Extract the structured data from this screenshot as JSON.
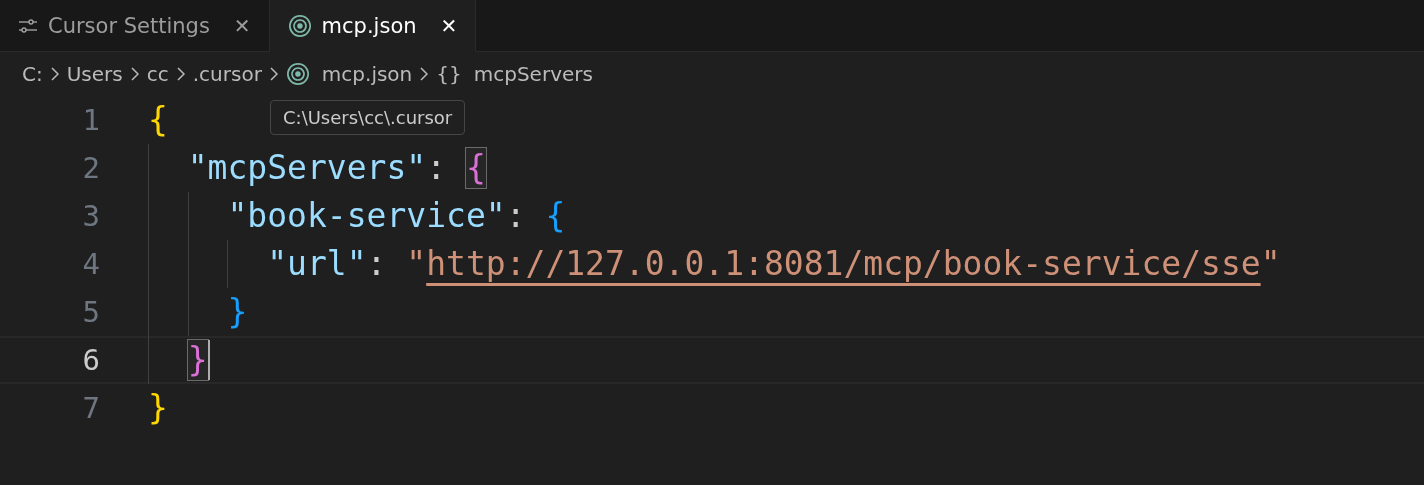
{
  "tabs": [
    {
      "label": "Cursor Settings",
      "kind": "settings",
      "selected": false,
      "close": "✕"
    },
    {
      "label": "mcp.json",
      "kind": "json",
      "selected": true,
      "close": "✕"
    }
  ],
  "breadcrumb": [
    {
      "label": "C:",
      "kind": "folder"
    },
    {
      "label": "Users",
      "kind": "folder"
    },
    {
      "label": "cc",
      "kind": "folder"
    },
    {
      "label": ".cursor",
      "kind": "folder"
    },
    {
      "label": "mcp.json",
      "kind": "file"
    },
    {
      "label": "mcpServers",
      "kind": "symbol",
      "symbol": "{}"
    }
  ],
  "tooltip": "C:\\Users\\cc\\.cursor",
  "editor": {
    "lines": [
      {
        "number": "1",
        "current": false,
        "cursor": false,
        "tokens": [
          {
            "kind": "brace1",
            "text": "{",
            "matched": false
          }
        ]
      },
      {
        "number": "2",
        "current": false,
        "cursor": false,
        "tokens": [
          {
            "kind": "key",
            "text": "\"mcpServers\"",
            "matched": false
          },
          {
            "kind": "punct",
            "text": ": ",
            "matched": false
          },
          {
            "kind": "brace2",
            "text": "{",
            "matched": true
          }
        ]
      },
      {
        "number": "3",
        "current": false,
        "cursor": false,
        "tokens": [
          {
            "kind": "key",
            "text": "\"book-service\"",
            "matched": false
          },
          {
            "kind": "punct",
            "text": ": ",
            "matched": false
          },
          {
            "kind": "brace3",
            "text": "{",
            "matched": false
          }
        ]
      },
      {
        "number": "4",
        "current": false,
        "cursor": false,
        "tokens": [
          {
            "kind": "key",
            "text": "\"url\"",
            "matched": false
          },
          {
            "kind": "punct",
            "text": ": ",
            "matched": false
          },
          {
            "kind": "string",
            "text": "\"",
            "matched": false
          },
          {
            "kind": "link",
            "text": "http://127.0.0.1:8081/mcp/book-service/sse",
            "matched": false
          },
          {
            "kind": "string",
            "text": "\"",
            "matched": false
          }
        ]
      },
      {
        "number": "5",
        "current": false,
        "cursor": false,
        "tokens": [
          {
            "kind": "brace3",
            "text": "}",
            "matched": false
          }
        ]
      },
      {
        "number": "6",
        "current": true,
        "cursor": true,
        "tokens": [
          {
            "kind": "brace2",
            "text": "}",
            "matched": true
          }
        ]
      },
      {
        "number": "7",
        "current": false,
        "cursor": false,
        "tokens": [
          {
            "kind": "brace1",
            "text": "}",
            "matched": false
          }
        ]
      }
    ]
  }
}
